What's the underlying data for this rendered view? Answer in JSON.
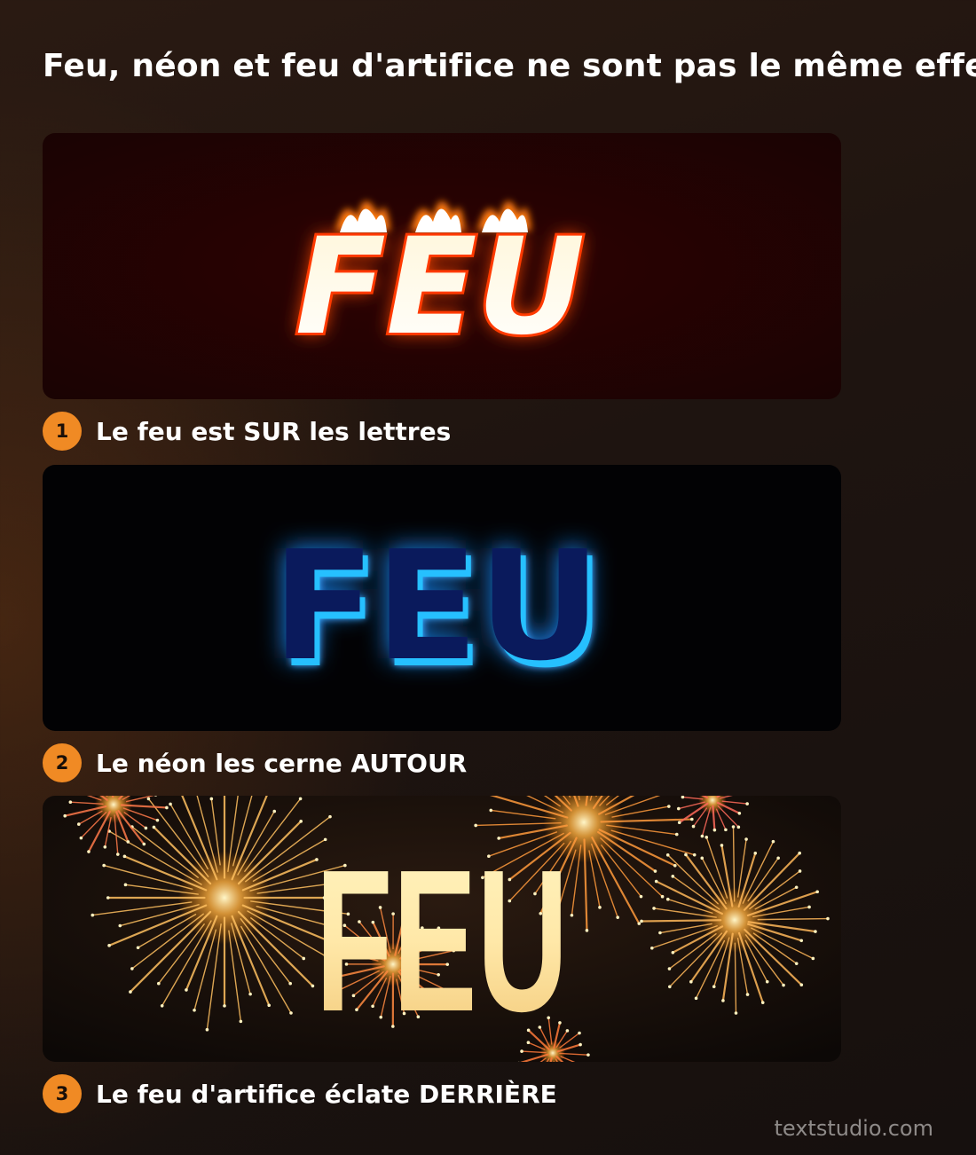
{
  "title": "Feu, néon et feu d'artifice ne sont pas le même effet",
  "effects": [
    {
      "number": "1",
      "word": "FEU",
      "caption": "Le feu est SUR les lettres",
      "style": "fire",
      "accent": "#ff5a00"
    },
    {
      "number": "2",
      "word": "FEU",
      "caption": "Le néon les cerne AUTOUR",
      "style": "neon",
      "accent": "#1e90ff"
    },
    {
      "number": "3",
      "word": "FEU",
      "caption": "Le feu d'artifice éclate DERRIÈRE",
      "style": "fireworks",
      "accent": "#ffb347"
    }
  ],
  "badge_color": "#f08a24",
  "watermark": "textstudio.com"
}
